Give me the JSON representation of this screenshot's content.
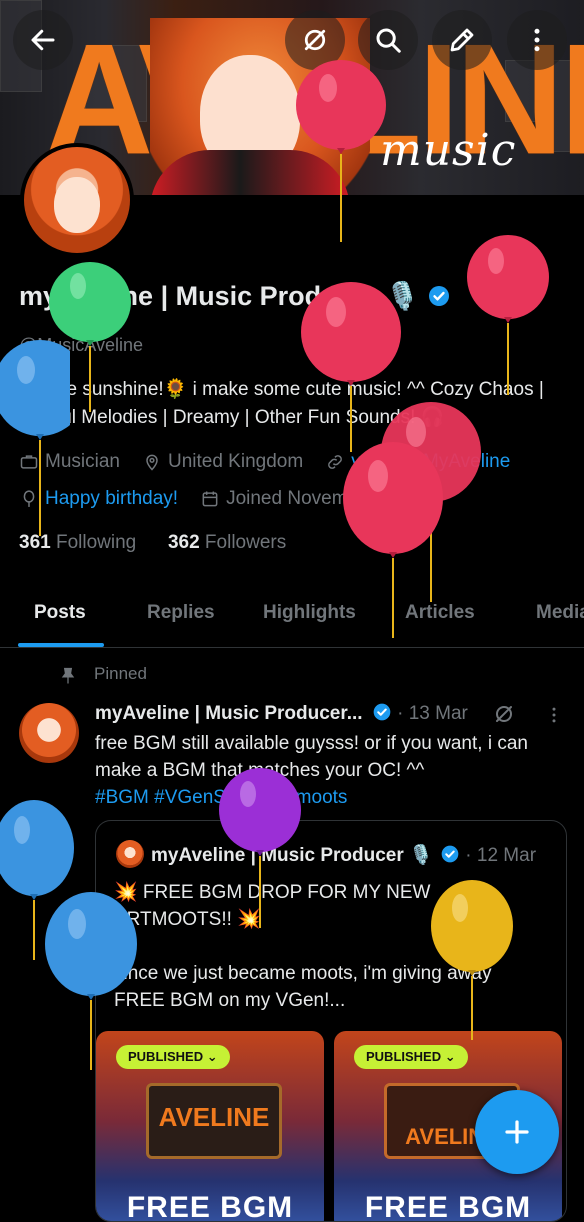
{
  "banner": {
    "word": "AVELINE",
    "script": "music"
  },
  "header_actions": [
    "back-arrow-icon",
    "grok-slash-icon",
    "search-icon",
    "edit-icon",
    "more-vertical-icon"
  ],
  "profile": {
    "name": "myAveline | Music Producer",
    "name_emoji": "🎙️",
    "handle": "@MusicAveline",
    "bio": "hii little sunshine!🌻 i make some cute music! ^^ Cozy Chaos | Playful Melodies | Dreamy | Other Fun Sounds! 🎧",
    "category": "Musician",
    "location": "United Kingdom",
    "link": "vgen.co/MyAveline",
    "birthday": "Happy birthday!",
    "joined": "Joined November 2025",
    "following_count": "361",
    "following_label": "Following",
    "followers_count": "362",
    "followers_label": "Followers"
  },
  "tabs": [
    "Posts",
    "Replies",
    "Highlights",
    "Articles",
    "Media"
  ],
  "post": {
    "pinned_label": "Pinned",
    "author": "myAveline | Music Producer...",
    "date": "· 13 Mar",
    "text": "free BGM still available guysss! or if you want, i can make a BGM that matches your OC! ^^",
    "hashtags": "#BGM #VGenShop #artmoots"
  },
  "quote": {
    "author": "myAveline | Music Producer",
    "author_emoji": "🎙️",
    "date": "· 12 Mar",
    "line1": "💥 FREE BGM DROP FOR MY NEW ARTMOOTS!! 💥",
    "line2": "since we just became moots, i'm giving away FREE BGM on my VGen!...",
    "images": [
      {
        "badge": "PUBLISHED ⌄",
        "logo": "AVELINE",
        "caption": "FREE BGM"
      },
      {
        "badge": "PUBLISHED ⌄",
        "logo": "AVELINE",
        "caption": "FREE BGM"
      }
    ]
  },
  "fab_icon": "plus-icon",
  "colors": {
    "accent": "#1d9bf0",
    "banner_orange": "#f07a1e",
    "badge_green": "#c6f135",
    "balloon_red": "#e8365a",
    "balloon_green": "#3ccf7a",
    "balloon_blue": "#3b94e0",
    "balloon_purple": "#9b2fd6",
    "balloon_yellow": "#e8b51a"
  }
}
